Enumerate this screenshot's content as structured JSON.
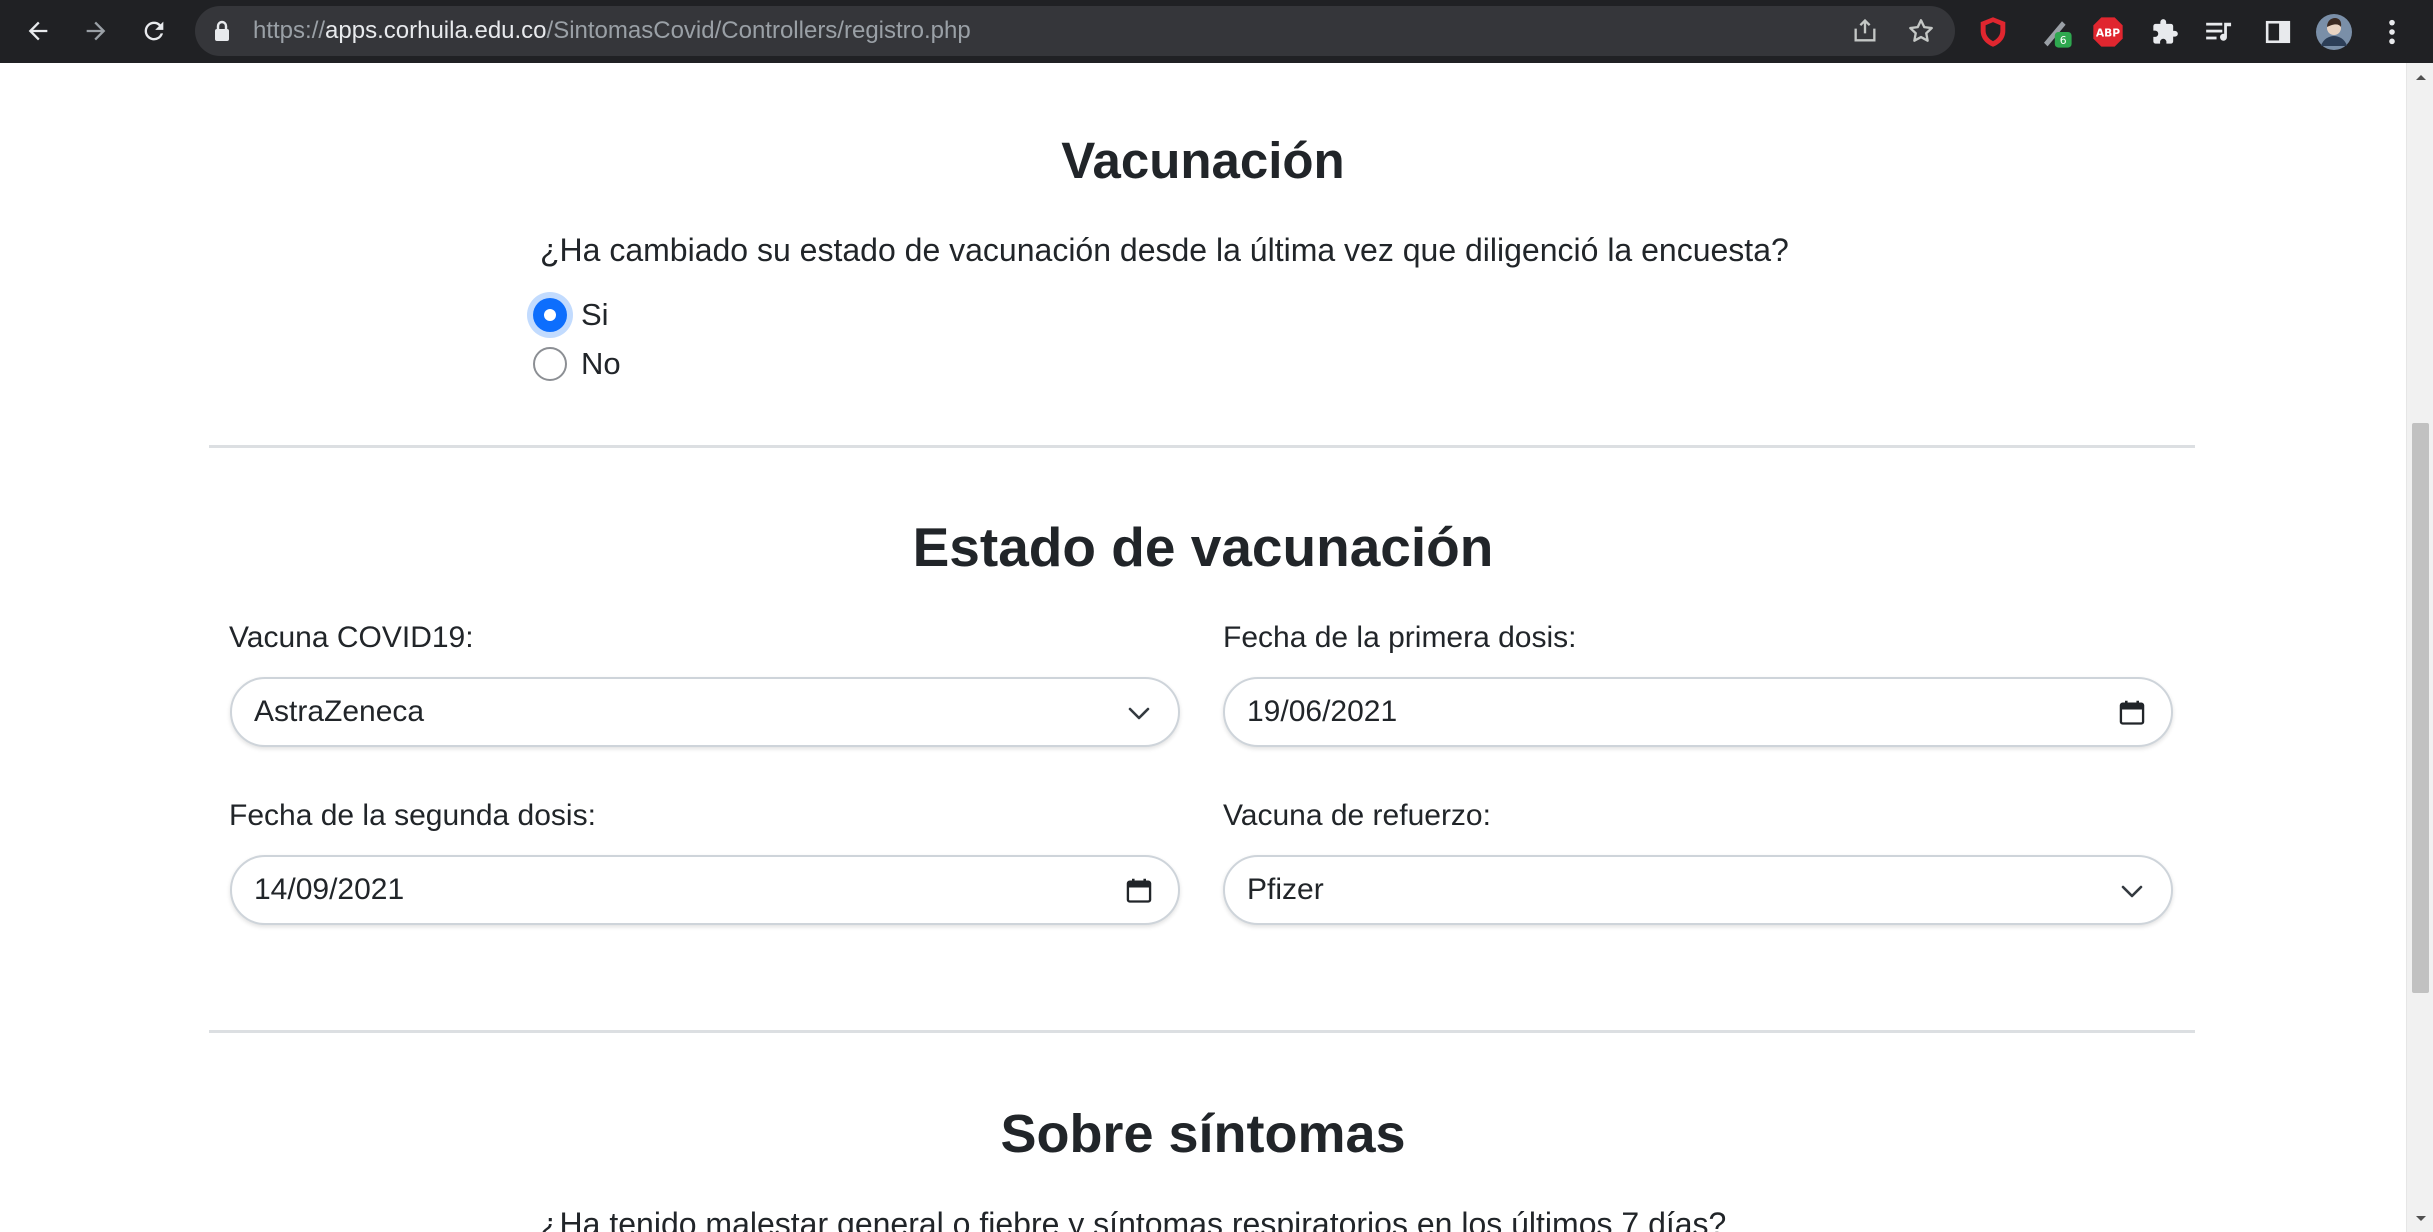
{
  "browser": {
    "url_scheme": "https://",
    "url_host": "apps.corhuila.edu.co",
    "url_path": "/SintomasCovid/Controllers/registro.php"
  },
  "vacunacion": {
    "title": "Vacunación",
    "question": "¿Ha cambiado su estado de vacunación desde la última vez que diligenció la encuesta?",
    "options": [
      {
        "label": "Si",
        "checked": true
      },
      {
        "label": "No",
        "checked": false
      }
    ]
  },
  "estado": {
    "title": "Estado de vacunación",
    "vacuna_label": "Vacuna COVID19:",
    "vacuna_value": "AstraZeneca",
    "primera_label": "Fecha de la primera dosis:",
    "primera_value": "19/06/2021",
    "segunda_label": "Fecha de la segunda dosis:",
    "segunda_value": "14/09/2021",
    "refuerzo_label": "Vacuna de refuerzo:",
    "refuerzo_value": "Pfizer"
  },
  "sintomas": {
    "title": "Sobre síntomas",
    "question": "¿Ha tenido malestar general o fiebre y síntomas respiratorios en los últimos 7 días?"
  },
  "icons": {
    "back": "arrow-left-icon",
    "forward": "arrow-right-icon",
    "reload": "reload-icon",
    "lock": "lock-icon",
    "share": "share-icon",
    "bookmark": "star-icon",
    "extensions": [
      "shield-extension-icon",
      "pen-extension-icon",
      "adblock-icon",
      "puzzle-icon",
      "media-icon",
      "side-panel-icon",
      "profile-avatar",
      "menu-kebab-icon"
    ],
    "select_caret": "chevron-down-icon",
    "date_picker": "calendar-icon"
  },
  "colors": {
    "accent": "#0d6efd",
    "chrome_bg": "#202124",
    "omnibox_bg": "#35363a",
    "divider": "#dcdfe2"
  }
}
